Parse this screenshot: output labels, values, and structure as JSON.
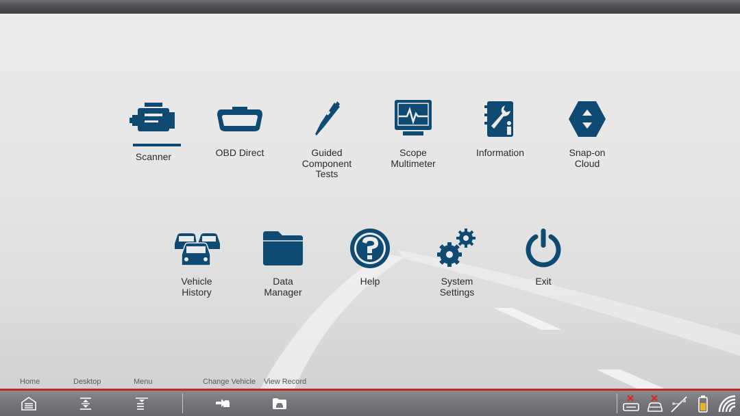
{
  "tiles_row1": [
    {
      "label": "Scanner",
      "icon": "engine-icon",
      "selected": true
    },
    {
      "label": "OBD Direct",
      "icon": "obd-connector-icon"
    },
    {
      "label": "Guided\nComponent\nTests",
      "icon": "test-probe-icon"
    },
    {
      "label": "Scope\nMultimeter",
      "icon": "scope-monitor-icon"
    },
    {
      "label": "Information",
      "icon": "info-book-icon"
    },
    {
      "label": "Snap-on\nCloud",
      "icon": "hexagon-arrows-icon"
    }
  ],
  "tiles_row2": [
    {
      "label": "Vehicle\nHistory",
      "icon": "vehicles-icon"
    },
    {
      "label": "Data\nManager",
      "icon": "folder-icon"
    },
    {
      "label": "Help",
      "icon": "help-icon"
    },
    {
      "label": "System\nSettings",
      "icon": "gears-icon"
    },
    {
      "label": "Exit",
      "icon": "power-icon"
    }
  ],
  "bottom_labels": {
    "home": "Home",
    "desktop": "Desktop",
    "menu": "Menu",
    "change_vehicle": "Change Vehicle",
    "view_record": "View Record"
  },
  "colors": {
    "icon_blue": "#0f4a72",
    "accent_red": "#c0272d",
    "status_red": "#d62b2b",
    "battery_yellow": "#e8b22a"
  }
}
